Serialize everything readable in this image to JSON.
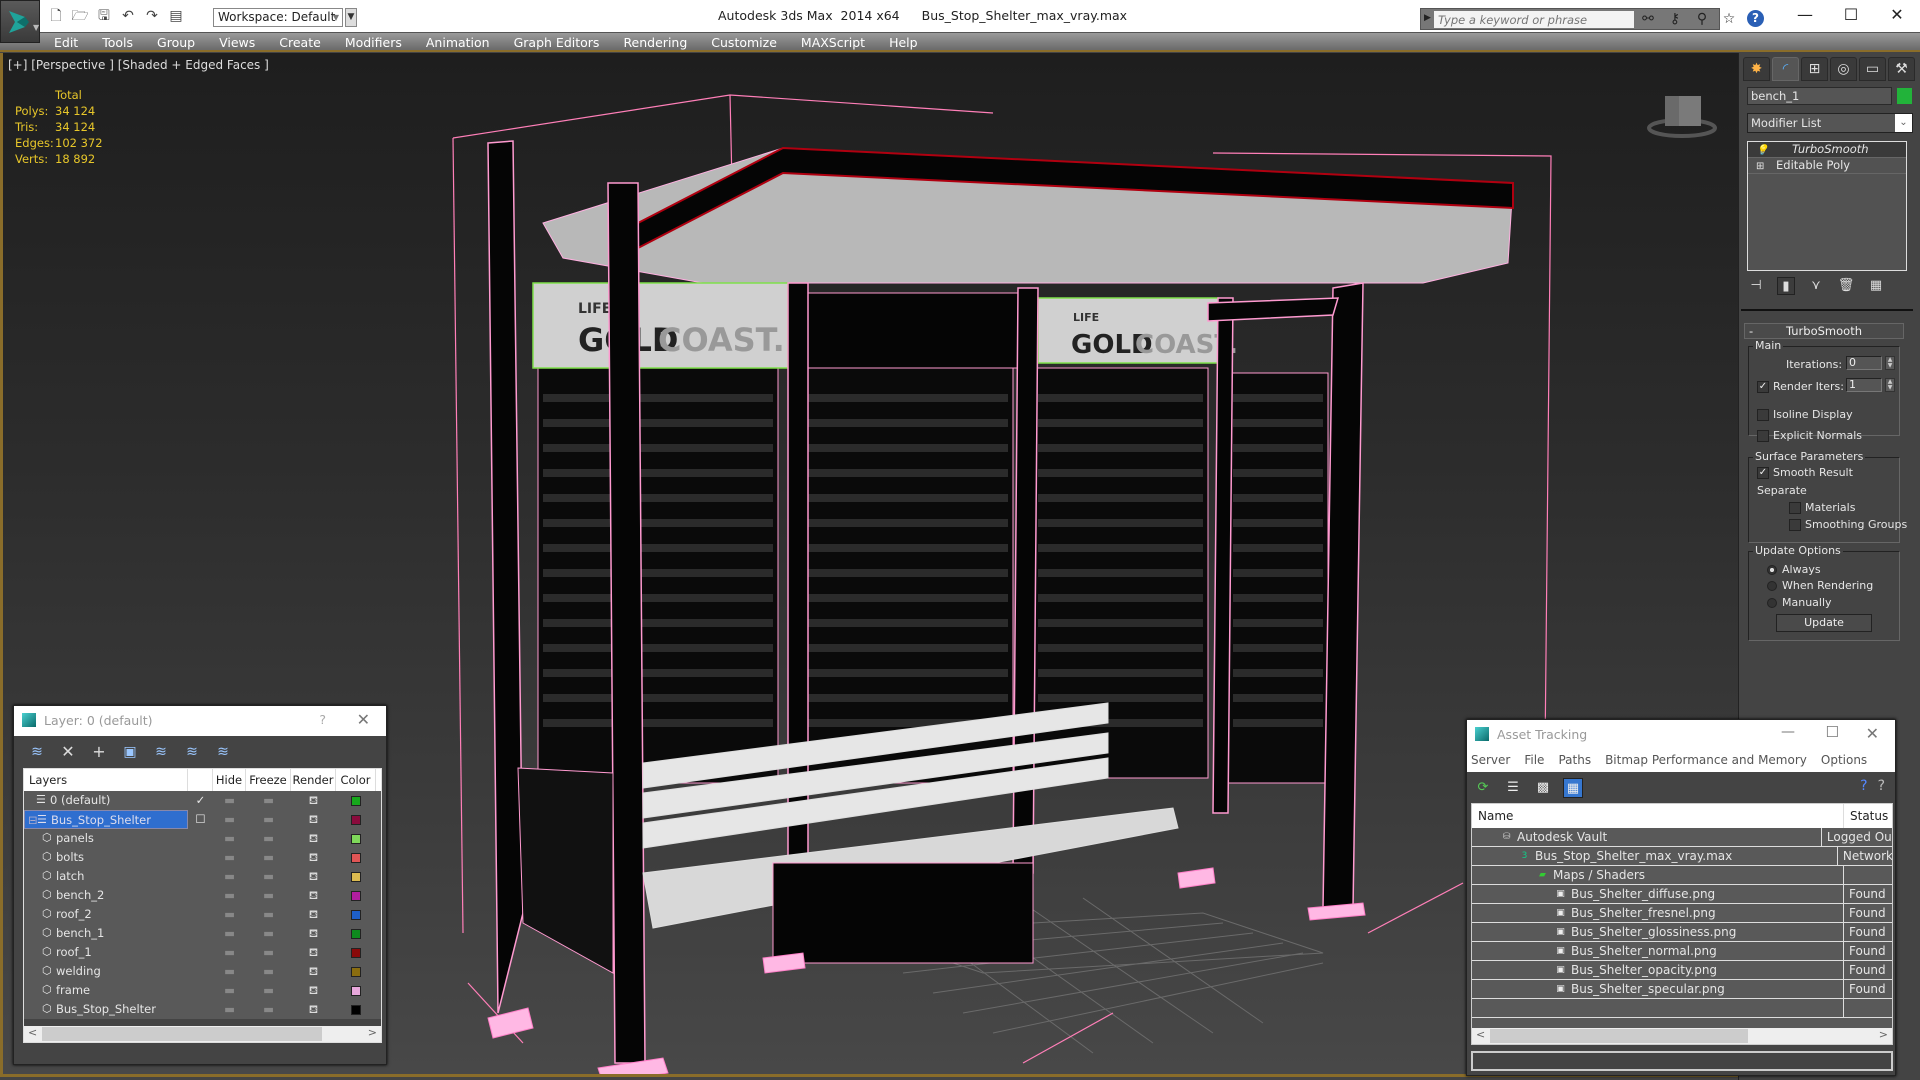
{
  "titlebar": {
    "app_name": "Autodesk 3ds Max  2014 x64",
    "file_name": "Bus_Stop_Shelter_max_vray.max",
    "workspace": "Workspace: Default",
    "search_placeholder": "Type a keyword or phrase",
    "quick_access_icons": [
      "new-file-icon",
      "open-folder-icon",
      "save-icon",
      "undo-icon",
      "redo-icon",
      "project-folder-icon"
    ],
    "search_tools": [
      "binoculars-icon",
      "key-icon",
      "satellite-icon",
      "star-icon",
      "help-icon"
    ],
    "window_controls": {
      "minimize": "—",
      "maximize": "☐",
      "close": "✕"
    }
  },
  "menu": [
    "Edit",
    "Tools",
    "Group",
    "Views",
    "Create",
    "Modifiers",
    "Animation",
    "Graph Editors",
    "Rendering",
    "Customize",
    "MAXScript",
    "Help"
  ],
  "viewport": {
    "label": "[+] [Perspective ] [Shaded + Edged Faces ]",
    "stats": {
      "header": "Total",
      "rows": [
        {
          "label": "Polys:",
          "value": "34 124"
        },
        {
          "label": "Tris:",
          "value": "34 124"
        },
        {
          "label": "Edges:",
          "value": "102 372"
        },
        {
          "label": "Verts:",
          "value": "18 892"
        }
      ]
    },
    "sign_text": {
      "small": "LIFE",
      "gold": "GOLD",
      "coast": "COAST."
    }
  },
  "command_panel": {
    "tabs": [
      "create-icon",
      "modify-icon",
      "hierarchy-icon",
      "motion-icon",
      "display-icon",
      "utilities-icon"
    ],
    "object_name": "bench_1",
    "object_color": "#22b33a",
    "modifier_list": "Modifier List",
    "stack": [
      {
        "label": "TurboSmooth",
        "selected": true
      },
      {
        "label": "Editable Poly",
        "selected": false
      }
    ],
    "rollout_title": "TurboSmooth",
    "main": {
      "title": "Main",
      "iterations_label": "Iterations:",
      "iterations": "0",
      "render_iters_label": "Render Iters:",
      "render_iters": "1",
      "render_iters_checked": true,
      "isoline_label": "Isoline Display",
      "explicit_normals_label": "Explicit Normals"
    },
    "surface": {
      "title": "Surface Parameters",
      "smooth_result_label": "Smooth Result",
      "separate_label": "Separate",
      "materials_label": "Materials",
      "smoothing_groups_label": "Smoothing Groups"
    },
    "update_options": {
      "title": "Update Options",
      "options": [
        "Always",
        "When Rendering",
        "Manually"
      ],
      "selected": "Always",
      "update_button": "Update"
    }
  },
  "layer_dialog": {
    "title": "Layer: 0 (default)",
    "help": "?",
    "columns": [
      "Layers",
      "",
      "Hide",
      "Freeze",
      "Render",
      "Color"
    ],
    "rows": [
      {
        "name": "0 (default)",
        "level": 0,
        "current": "✓",
        "color": "#17a81c"
      },
      {
        "name": "Bus_Stop_Shelter",
        "level": 0,
        "selected": true,
        "current": "☐",
        "color": "#8a0a3c"
      },
      {
        "name": "panels",
        "level": 1,
        "color": "#7fd85a"
      },
      {
        "name": "bolts",
        "level": 1,
        "color": "#e05555"
      },
      {
        "name": "latch",
        "level": 1,
        "color": "#dcbb50"
      },
      {
        "name": "bench_2",
        "level": 1,
        "color": "#b01ea0"
      },
      {
        "name": "roof_2",
        "level": 1,
        "color": "#1e5fc8"
      },
      {
        "name": "bench_1",
        "level": 1,
        "color": "#0e8a1e"
      },
      {
        "name": "roof_1",
        "level": 1,
        "color": "#8a0a0a"
      },
      {
        "name": "welding",
        "level": 1,
        "color": "#8a6d10"
      },
      {
        "name": "frame",
        "level": 1,
        "color": "#e8a8dc"
      },
      {
        "name": "Bus_Stop_Shelter",
        "level": 1,
        "color": "#000000"
      }
    ]
  },
  "asset_dialog": {
    "title": "Asset Tracking",
    "menu": [
      "Server",
      "File",
      "Paths",
      "Bitmap Performance and Memory",
      "Options"
    ],
    "columns": [
      "Name",
      "Status"
    ],
    "rows": [
      {
        "name": "Autodesk Vault",
        "status": "Logged Out",
        "level": 1,
        "icon": "vault-icon"
      },
      {
        "name": "Bus_Stop_Shelter_max_vray.max",
        "status": "Network",
        "level": 2,
        "icon": "max-file-icon"
      },
      {
        "name": "Maps / Shaders",
        "status": "",
        "level": 3,
        "icon": "maps-folder-icon"
      },
      {
        "name": "Bus_Shelter_diffuse.png",
        "status": "Found",
        "level": 4,
        "icon": "bitmap-icon"
      },
      {
        "name": "Bus_Shelter_fresnel.png",
        "status": "Found",
        "level": 4,
        "icon": "bitmap-icon"
      },
      {
        "name": "Bus_Shelter_glossiness.png",
        "status": "Found",
        "level": 4,
        "icon": "bitmap-icon"
      },
      {
        "name": "Bus_Shelter_normal.png",
        "status": "Found",
        "level": 4,
        "icon": "bitmap-icon"
      },
      {
        "name": "Bus_Shelter_opacity.png",
        "status": "Found",
        "level": 4,
        "icon": "bitmap-icon"
      },
      {
        "name": "Bus_Shelter_specular.png",
        "status": "Found",
        "level": 4,
        "icon": "bitmap-icon"
      }
    ]
  }
}
